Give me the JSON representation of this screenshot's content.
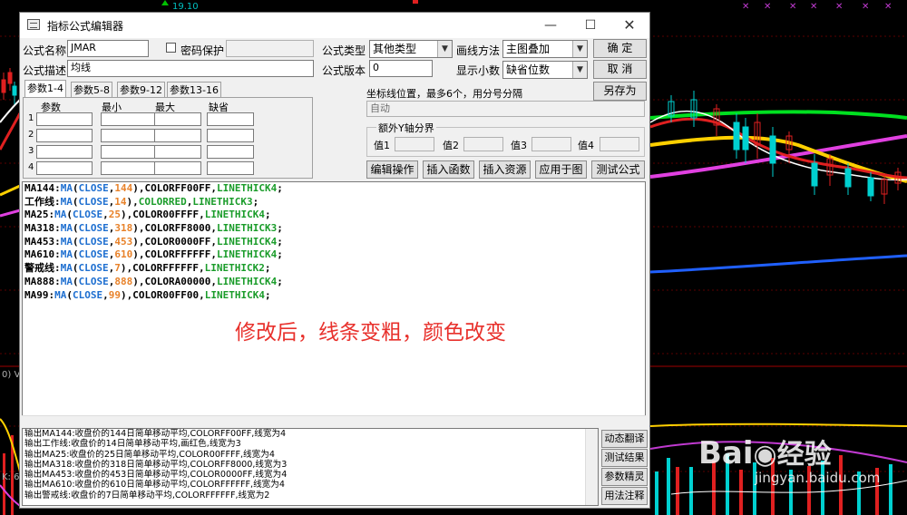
{
  "background": {
    "price_label": "19.10",
    "axis_label": "0) V",
    "axis_label_2": "K: 6"
  },
  "dialog": {
    "title": "指标公式编辑器",
    "formula_name_label": "公式名称",
    "formula_name_value": "JMAR",
    "password_label": "密码保护",
    "password_checked": false,
    "formula_desc_label": "公式描述",
    "formula_desc_value": "均线",
    "formula_type_label": "公式类型",
    "formula_type_value": "其他类型",
    "draw_method_label": "画线方法",
    "draw_method_value": "主图叠加",
    "formula_version_label": "公式版本",
    "formula_version_value": "0",
    "decimal_label": "显示小数",
    "decimal_value": "缺省位数",
    "ok_button": "确  定",
    "cancel_button": "取  消",
    "save_as_button": "另存为",
    "tabs": [
      "参数1-4",
      "参数5-8",
      "参数9-12",
      "参数13-16"
    ],
    "param_headers": [
      "参数",
      "最小",
      "最大",
      "缺省"
    ],
    "param_rows": [
      "1",
      "2",
      "3",
      "4"
    ],
    "coord_label": "坐标线位置，最多6个，用分号分隔",
    "coord_value": "自动",
    "yaxis_group_label": "额外Y轴分界",
    "yaxis_values": [
      "值1",
      "值2",
      "值3",
      "值4"
    ],
    "action_buttons": [
      "编辑操作",
      "插入函数",
      "插入资源",
      "应用于图",
      "测试公式"
    ],
    "code_lines": [
      [
        [
          "MA144:",
          "k"
        ],
        [
          "MA",
          "f"
        ],
        [
          "(",
          "k"
        ],
        [
          "CLOSE",
          "v"
        ],
        [
          ",",
          "k"
        ],
        [
          "144",
          "n"
        ],
        [
          "),COLORFF00FF,",
          "k"
        ],
        [
          "LINETHICK4",
          "t"
        ],
        [
          ";",
          "k"
        ]
      ],
      [
        [
          "工作线:",
          "k"
        ],
        [
          "MA",
          "f"
        ],
        [
          "(",
          "k"
        ],
        [
          "CLOSE",
          "v"
        ],
        [
          ",",
          "k"
        ],
        [
          "14",
          "n"
        ],
        [
          "),",
          "k"
        ],
        [
          "COLORRED",
          "t"
        ],
        [
          ",",
          "k"
        ],
        [
          "LINETHICK3",
          "t"
        ],
        [
          ";",
          "k"
        ]
      ],
      [
        [
          "MA25:",
          "k"
        ],
        [
          "MA",
          "f"
        ],
        [
          "(",
          "k"
        ],
        [
          "CLOSE",
          "v"
        ],
        [
          ",",
          "k"
        ],
        [
          "25",
          "n"
        ],
        [
          "),COLOR00FFFF,",
          "k"
        ],
        [
          "LINETHICK4",
          "t"
        ],
        [
          ";",
          "k"
        ]
      ],
      [
        [
          "MA318:",
          "k"
        ],
        [
          "MA",
          "f"
        ],
        [
          "(",
          "k"
        ],
        [
          "CLOSE",
          "v"
        ],
        [
          ",",
          "k"
        ],
        [
          "318",
          "n"
        ],
        [
          "),COLORFF8000,",
          "k"
        ],
        [
          "LINETHICK3",
          "t"
        ],
        [
          ";",
          "k"
        ]
      ],
      [
        [
          "MA453:",
          "k"
        ],
        [
          "MA",
          "f"
        ],
        [
          "(",
          "k"
        ],
        [
          "CLOSE",
          "v"
        ],
        [
          ",",
          "k"
        ],
        [
          "453",
          "n"
        ],
        [
          "),COLOR0000FF,",
          "k"
        ],
        [
          "LINETHICK4",
          "t"
        ],
        [
          ";",
          "k"
        ]
      ],
      [
        [
          "MA610:",
          "k"
        ],
        [
          "MA",
          "f"
        ],
        [
          "(",
          "k"
        ],
        [
          "CLOSE",
          "v"
        ],
        [
          ",",
          "k"
        ],
        [
          "610",
          "n"
        ],
        [
          "),COLORFFFFFF,",
          "k"
        ],
        [
          "LINETHICK4",
          "t"
        ],
        [
          ";",
          "k"
        ]
      ],
      [
        [
          "警戒线:",
          "k"
        ],
        [
          "MA",
          "f"
        ],
        [
          "(",
          "k"
        ],
        [
          "CLOSE",
          "v"
        ],
        [
          ",",
          "k"
        ],
        [
          "7",
          "n"
        ],
        [
          "),COLORFFFFFF,",
          "k"
        ],
        [
          "LINETHICK2",
          "t"
        ],
        [
          ";",
          "k"
        ]
      ],
      [
        [
          "MA888:",
          "k"
        ],
        [
          "MA",
          "f"
        ],
        [
          "(",
          "k"
        ],
        [
          "CLOSE",
          "v"
        ],
        [
          ",",
          "k"
        ],
        [
          "888",
          "n"
        ],
        [
          "),COLORA00000,",
          "k"
        ],
        [
          "LINETHICK4",
          "t"
        ],
        [
          ";",
          "k"
        ]
      ],
      [
        [
          "MA99:",
          "k"
        ],
        [
          "MA",
          "f"
        ],
        [
          "(",
          "k"
        ],
        [
          "CLOSE",
          "v"
        ],
        [
          ",",
          "k"
        ],
        [
          "99",
          "n"
        ],
        [
          "),COLOR00FF00,",
          "k"
        ],
        [
          "LINETHICK4",
          "t"
        ],
        [
          ";",
          "k"
        ]
      ]
    ],
    "code_colors": {
      "k": "#000000",
      "f": "#1e6fd0",
      "v": "#1e6fd0",
      "n": "#e8822a",
      "t": "#1a9c2a"
    },
    "annotation": "修改后，线条变粗，颜色改变",
    "output_lines": [
      "输出MA144:收盘价的144日简单移动平均,COLORFF00FF,线宽为4",
      "输出工作线:收盘价的14日简单移动平均,画红色,线宽为3",
      "输出MA25:收盘价的25日简单移动平均,COLOR00FFFF,线宽为4",
      "输出MA318:收盘价的318日简单移动平均,COLORFF8000,线宽为3",
      "输出MA453:收盘价的453日简单移动平均,COLOR0000FF,线宽为4",
      "输出MA610:收盘价的610日简单移动平均,COLORFFFFFF,线宽为4",
      "输出警戒线:收盘价的7日简单移动平均,COLORFFFFFF,线宽为2"
    ],
    "side_buttons": [
      "动态翻译",
      "测试结果",
      "参数精灵",
      "用法注释"
    ]
  },
  "watermark": {
    "brand_1": "Bai",
    "brand_2": "经验",
    "url": "jingyan.baidu.com"
  }
}
